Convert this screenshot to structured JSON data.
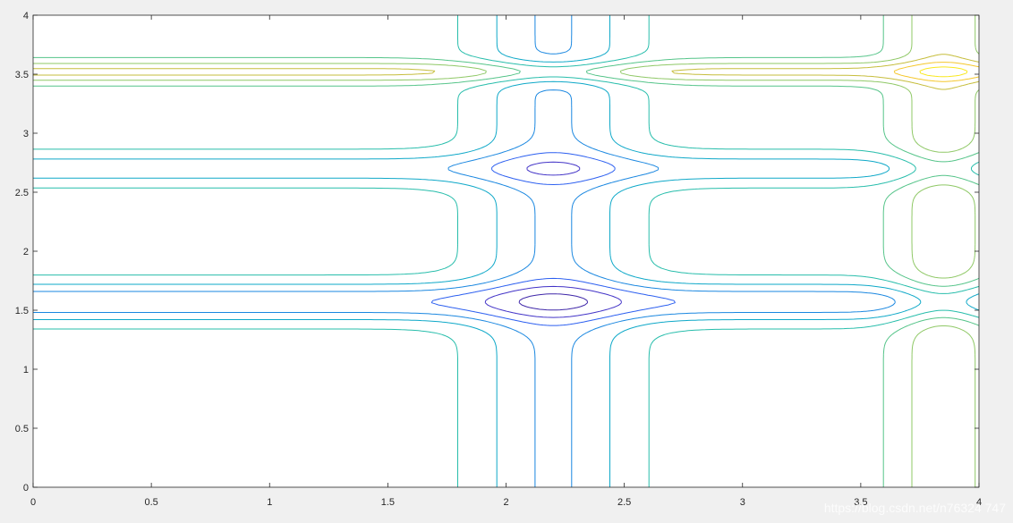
{
  "chart_data": {
    "type": "contour",
    "title": "",
    "xlabel": "",
    "ylabel": "",
    "xlim": [
      0,
      4
    ],
    "ylim": [
      0,
      4
    ],
    "xticks": [
      "0",
      "0.5",
      "1",
      "1.5",
      "2",
      "2.5",
      "3",
      "3.5",
      "4"
    ],
    "yticks": [
      "0",
      "0.5",
      "1",
      "1.5",
      "2",
      "2.5",
      "3",
      "3.5",
      "4"
    ],
    "grid": false,
    "legend": "none",
    "colormap": "parula",
    "features": {
      "vertical_bands": [
        {
          "x_center": 2.2,
          "kind": "valley"
        },
        {
          "x_center": 3.85,
          "kind": "ridge"
        }
      ],
      "horizontal_bands": [
        {
          "y_center": 1.57,
          "kind": "valley"
        },
        {
          "y_center": 2.7,
          "kind": "valley"
        },
        {
          "y_center": 3.52,
          "kind": "ridge"
        }
      ],
      "minimum": {
        "x": 2.2,
        "y": 1.57
      },
      "maximum": {
        "x": 3.85,
        "y": 3.52
      }
    },
    "level_colors": [
      "#3e26a8",
      "#4233c7",
      "#2c5ff0",
      "#1a87e0",
      "#0ea8c8",
      "#27bdab",
      "#55c489",
      "#8fc866",
      "#c6bd3c",
      "#f5c72c",
      "#f9e81e"
    ]
  },
  "watermark": "https://blog.csdn.net/n76324 747"
}
